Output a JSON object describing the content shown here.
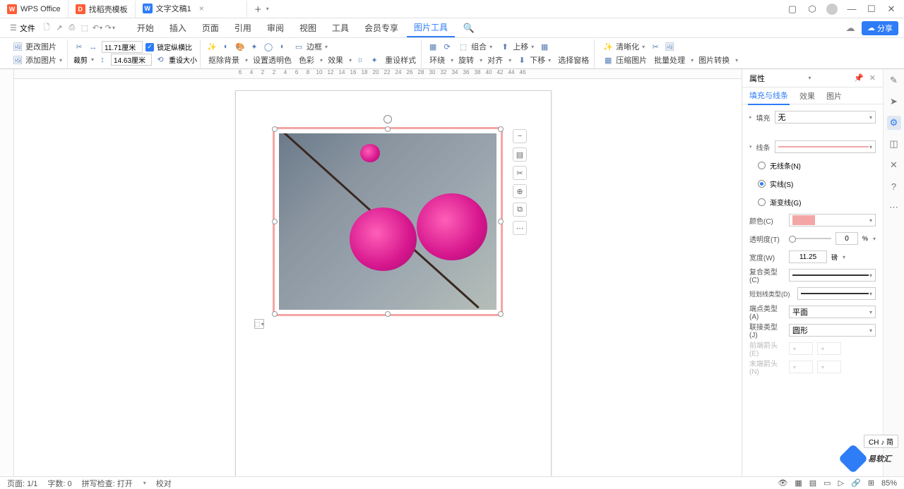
{
  "titlebar": {
    "app": "WPS Office",
    "tabs": [
      {
        "icon_bg": "#ff5c35",
        "icon": "D",
        "label": "找稻壳模板"
      },
      {
        "icon_bg": "#2e7cf6",
        "icon": "W",
        "label": "文字文稿1",
        "active": true
      }
    ],
    "add": "＋"
  },
  "menubar": {
    "file": "文件",
    "items": [
      "开始",
      "插入",
      "页面",
      "引用",
      "审阅",
      "视图",
      "工具",
      "会员专享",
      "图片工具"
    ],
    "active": "图片工具",
    "share": "分享"
  },
  "ribbon": {
    "change_img": "更改图片",
    "add_img": "添加图片",
    "crop": "裁剪",
    "w_val": "11.71厘米",
    "h_val": "14.63厘米",
    "lock": "锁定纵横比",
    "reset": "重设大小",
    "remove_bg": "抠除背景",
    "set_trans": "设置透明色",
    "color": "色彩",
    "effect": "效果",
    "border": "边框",
    "style": "重设样式",
    "wrap": "环绕",
    "rotate": "旋转",
    "align": "对齐",
    "group": "组合",
    "up": "上移",
    "down": "下移",
    "sel_pane": "选择窗格",
    "clarity": "清晰化",
    "compress": "压缩图片",
    "batch": "批量处理",
    "convert": "图片转换"
  },
  "ruler": {
    "ticks": [
      "6",
      "4",
      "2",
      "2",
      "4",
      "6",
      "8",
      "10",
      "12",
      "14",
      "16",
      "18",
      "20",
      "22",
      "24",
      "26",
      "28",
      "30",
      "32",
      "34",
      "36",
      "38",
      "40",
      "42",
      "44",
      "46"
    ]
  },
  "side": {
    "title": "属性",
    "tabs": [
      "填充与线条",
      "效果",
      "图片"
    ],
    "active_tab": "填充与线条",
    "fill": "填充",
    "fill_val": "无",
    "line": "线条",
    "radio": [
      {
        "label": "无线条(N)",
        "on": false
      },
      {
        "label": "实线(S)",
        "on": true
      },
      {
        "label": "渐变线(G)",
        "on": false
      }
    ],
    "color_l": "颜色(C)",
    "color_v": "#f4a6a6",
    "trans_l": "透明度(T)",
    "trans_v": "0",
    "trans_u": "%",
    "width_l": "宽度(W)",
    "width_v": "11.25",
    "width_u": "磅",
    "compound_l": "复合类型(C)",
    "dash_l": "短划线类型(D)",
    "cap_l": "端点类型(A)",
    "cap_v": "平面",
    "join_l": "联接类型(J)",
    "join_v": "圆形",
    "arrow1_l": "前端箭头(E)",
    "arrow2_l": "末端箭头(N)"
  },
  "status": {
    "page": "页面: 1/1",
    "words": "字数: 0",
    "spell": "拼写检查: 打开",
    "proof": "校对",
    "zoom": "85%"
  },
  "ch": "CH ♪ 简",
  "watermark": "易软汇"
}
